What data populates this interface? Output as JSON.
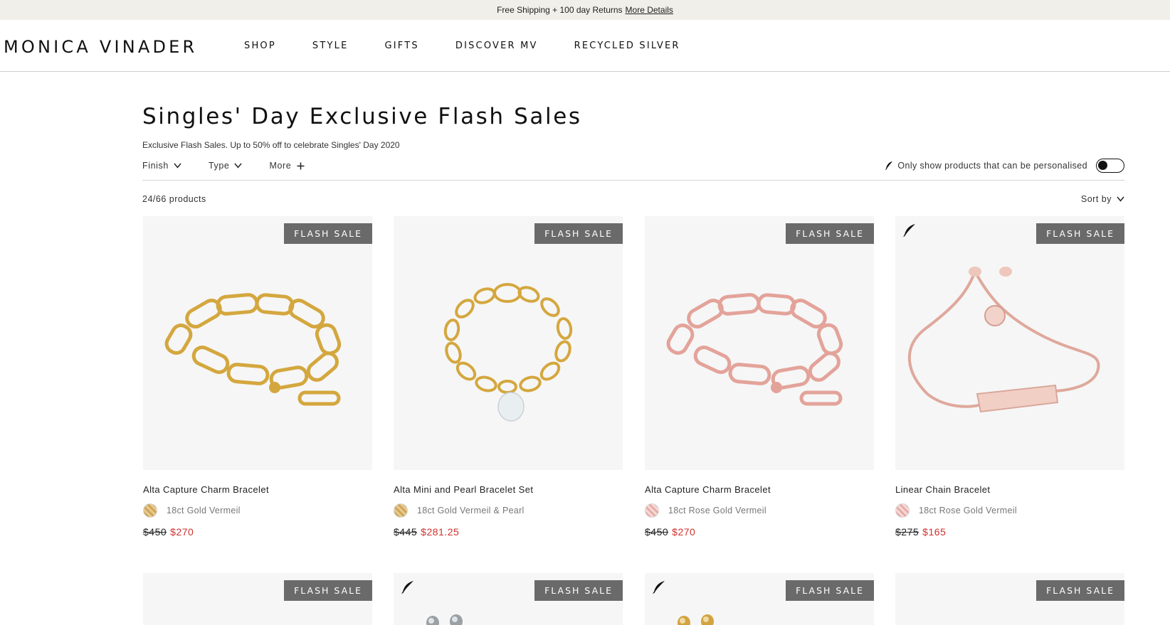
{
  "promo": {
    "text": "Free Shipping + 100 day Returns",
    "link": "More Details"
  },
  "header": {
    "logo": "MONICA VINADER",
    "nav": [
      "SHOP",
      "STYLE",
      "GIFTS",
      "DISCOVER MV",
      "RECYCLED SILVER"
    ]
  },
  "page": {
    "title": "Singles' Day Exclusive Flash Sales",
    "subtitle": "Exclusive Flash Sales. Up to 50% off to celebrate Singles' Day 2020"
  },
  "filters": {
    "finish": "Finish",
    "type": "Type",
    "more": "More"
  },
  "personalise": {
    "label": "Only show products that can be personalised",
    "enabled": false
  },
  "listing": {
    "count": "24/66 products",
    "sort": "Sort by"
  },
  "colors": {
    "sale_price": "#d0312d",
    "badge_bg": "#6a6a6a",
    "promo_bg": "#f1efe9"
  },
  "products": [
    {
      "badge": "FLASH SALE",
      "name": "Alta Capture Charm Bracelet",
      "finish": "18ct Gold Vermeil",
      "finish_color": "#d9b77a",
      "price_old": "$450",
      "price_new": "$270",
      "personalisable": false,
      "image_icon": "gold-link-bracelet"
    },
    {
      "badge": "FLASH SALE",
      "name": "Alta Mini and Pearl Bracelet Set",
      "finish": "18ct Gold Vermeil & Pearl",
      "finish_color": "#d9b77a",
      "price_old": "$445",
      "price_new": "$281.25",
      "personalisable": false,
      "image_icon": "gold-chain-pearl-bracelet"
    },
    {
      "badge": "FLASH SALE",
      "name": "Alta Capture Charm Bracelet",
      "finish": "18ct Rose Gold Vermeil",
      "finish_color": "#eec2c0",
      "price_old": "$450",
      "price_new": "$270",
      "personalisable": false,
      "image_icon": "rose-gold-link-bracelet"
    },
    {
      "badge": "FLASH SALE",
      "name": "Linear Chain Bracelet",
      "finish": "18ct Rose Gold Vermeil",
      "finish_color": "#eec2c0",
      "price_old": "$275",
      "price_new": "$165",
      "personalisable": true,
      "image_icon": "rose-gold-bar-bracelet"
    }
  ],
  "products_row2": [
    {
      "badge": "FLASH SALE",
      "personalisable": false
    },
    {
      "badge": "FLASH SALE",
      "personalisable": true
    },
    {
      "badge": "FLASH SALE",
      "personalisable": true
    },
    {
      "badge": "FLASH SALE",
      "personalisable": false
    }
  ]
}
